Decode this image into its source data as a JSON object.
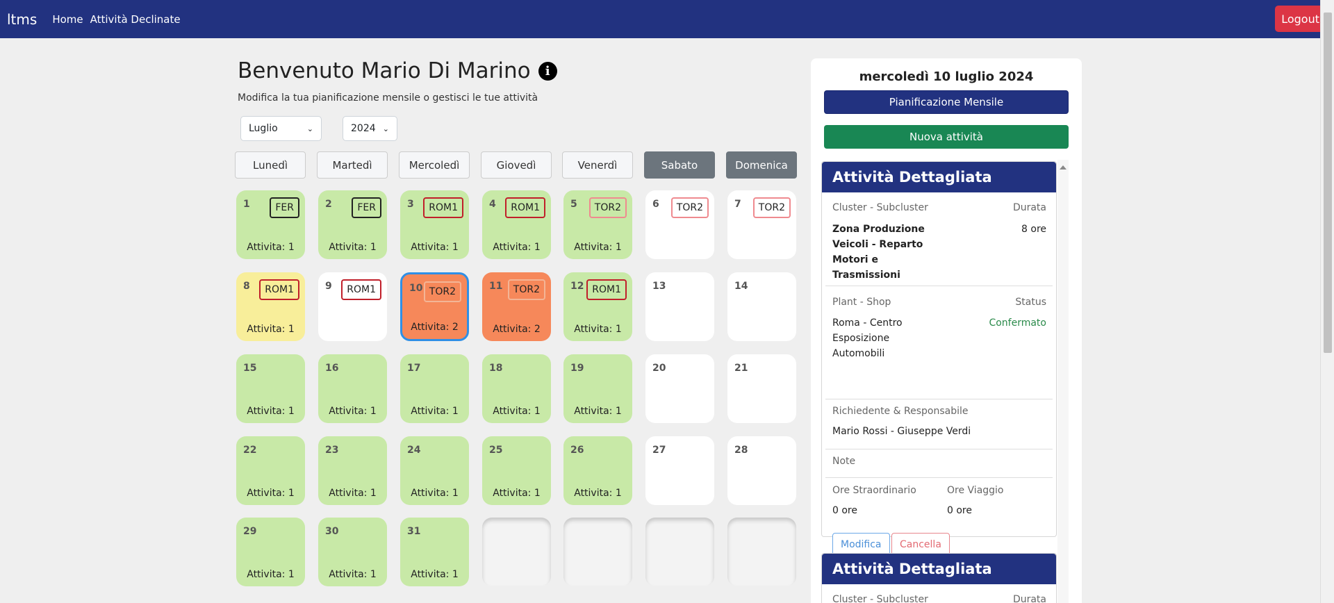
{
  "navbar": {
    "brand": "ltms",
    "links": [
      "Home",
      "Attività Declinate"
    ],
    "logout": "Logout"
  },
  "header": {
    "title": "Benvenuto Mario Di Marino",
    "subtitle": "Modifica la tua pianificazione mensile o gestisci le tue attività"
  },
  "filters": {
    "month": "Luglio",
    "year": "2024"
  },
  "weekdays": [
    "Lunedì",
    "Martedì",
    "Mercoledì",
    "Giovedì",
    "Venerdì",
    "Sabato",
    "Domenica"
  ],
  "calendar": [
    {
      "day": "1",
      "badge": "FER",
      "badge_style": "dark",
      "activities": "Attivita: 1",
      "color": "green"
    },
    {
      "day": "2",
      "badge": "FER",
      "badge_style": "dark",
      "activities": "Attivita: 1",
      "color": "green"
    },
    {
      "day": "3",
      "badge": "ROM1",
      "badge_style": "red",
      "activities": "Attivita: 1",
      "color": "green"
    },
    {
      "day": "4",
      "badge": "ROM1",
      "badge_style": "red",
      "activities": "Attivita: 1",
      "color": "green"
    },
    {
      "day": "5",
      "badge": "TOR2",
      "badge_style": "light",
      "activities": "Attivita: 1",
      "color": "green"
    },
    {
      "day": "6",
      "badge": "TOR2",
      "badge_style": "light",
      "activities": "",
      "color": "white"
    },
    {
      "day": "7",
      "badge": "TOR2",
      "badge_style": "light",
      "activities": "",
      "color": "white"
    },
    {
      "day": "8",
      "badge": "ROM1",
      "badge_style": "red",
      "activities": "Attivita: 1",
      "color": "yellow"
    },
    {
      "day": "9",
      "badge": "ROM1",
      "badge_style": "red",
      "activities": "",
      "color": "white"
    },
    {
      "day": "10",
      "badge": "TOR2",
      "badge_style": "pale",
      "activities": "Attivita: 2",
      "color": "orange",
      "selected": true
    },
    {
      "day": "11",
      "badge": "TOR2",
      "badge_style": "pale",
      "activities": "Attivita: 2",
      "color": "orange"
    },
    {
      "day": "12",
      "badge": "ROM1",
      "badge_style": "red",
      "activities": "Attivita: 1",
      "color": "green"
    },
    {
      "day": "13",
      "badge": "",
      "activities": "",
      "color": "white"
    },
    {
      "day": "14",
      "badge": "",
      "activities": "",
      "color": "white"
    },
    {
      "day": "15",
      "badge": "",
      "activities": "Attivita: 1",
      "color": "green"
    },
    {
      "day": "16",
      "badge": "",
      "activities": "Attivita: 1",
      "color": "green"
    },
    {
      "day": "17",
      "badge": "",
      "activities": "Attivita: 1",
      "color": "green"
    },
    {
      "day": "18",
      "badge": "",
      "activities": "Attivita: 1",
      "color": "green"
    },
    {
      "day": "19",
      "badge": "",
      "activities": "Attivita: 1",
      "color": "green"
    },
    {
      "day": "20",
      "badge": "",
      "activities": "",
      "color": "white"
    },
    {
      "day": "21",
      "badge": "",
      "activities": "",
      "color": "white"
    },
    {
      "day": "22",
      "badge": "",
      "activities": "Attivita: 1",
      "color": "green"
    },
    {
      "day": "23",
      "badge": "",
      "activities": "Attivita: 1",
      "color": "green"
    },
    {
      "day": "24",
      "badge": "",
      "activities": "Attivita: 1",
      "color": "green"
    },
    {
      "day": "25",
      "badge": "",
      "activities": "Attivita: 1",
      "color": "green"
    },
    {
      "day": "26",
      "badge": "",
      "activities": "Attivita: 1",
      "color": "green"
    },
    {
      "day": "27",
      "badge": "",
      "activities": "",
      "color": "white"
    },
    {
      "day": "28",
      "badge": "",
      "activities": "",
      "color": "white"
    },
    {
      "day": "29",
      "badge": "",
      "activities": "Attivita: 1",
      "color": "green"
    },
    {
      "day": "30",
      "badge": "",
      "activities": "Attivita: 1",
      "color": "green"
    },
    {
      "day": "31",
      "badge": "",
      "activities": "Attivita: 1",
      "color": "green"
    },
    {
      "day": "",
      "badge": "",
      "activities": "",
      "color": "empty"
    },
    {
      "day": "",
      "badge": "",
      "activities": "",
      "color": "empty"
    },
    {
      "day": "",
      "badge": "",
      "activities": "",
      "color": "empty"
    },
    {
      "day": "",
      "badge": "",
      "activities": "",
      "color": "empty"
    }
  ],
  "panel": {
    "date": "mercoledì 10 luglio 2024",
    "plan_button": "Pianificazione Mensile",
    "new_button": "Nuova attività"
  },
  "detail": {
    "header": "Attività Dettagliata",
    "cluster_label": "Cluster - Subcluster",
    "duration_label": "Durata",
    "cluster_lines": [
      "Zona Produzione",
      "Veicoli - Reparto",
      "Motori e",
      "Trasmissioni"
    ],
    "duration": "8 ore",
    "plant_label": "Plant - Shop",
    "status_label": "Status",
    "plant_lines": [
      "Roma - Centro",
      "Esposizione",
      "Automobili"
    ],
    "status": "Confermato",
    "requester_label": "Richiedente & Responsabile",
    "requester": "Mario Rossi - Giuseppe Verdi",
    "note_label": "Note",
    "overtime_label": "Ore Straordinario",
    "travel_label": "Ore Viaggio",
    "overtime": "0 ore",
    "travel": "0 ore",
    "edit_button": "Modifica",
    "delete_button": "Cancella"
  },
  "detail2": {
    "header": "Attività Dettagliata",
    "cluster_label": "Cluster - Subcluster",
    "duration_label": "Durata"
  }
}
